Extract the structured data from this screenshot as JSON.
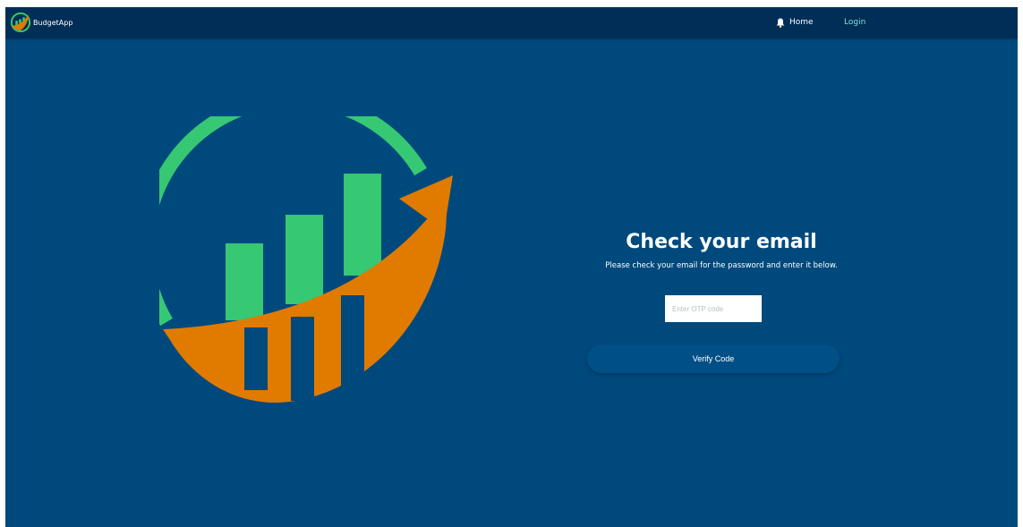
{
  "colors": {
    "page_background": "#00497d",
    "navbar_background": "#002e56",
    "login_link": "#7fe3d9",
    "logo_green": "#36c872",
    "logo_orange": "#e07b00",
    "button_background": "#004f86"
  },
  "navbar": {
    "brand_name": "BudgetApp",
    "brand_icon": "chart-growth-icon",
    "home_icon": "bell-icon",
    "home_label": "Home",
    "login_label": "Login"
  },
  "hero": {
    "logo_icon": "growth-chart-logo-icon"
  },
  "verify": {
    "title": "Check your email",
    "subtitle": "Please check your email for the password and enter it below.",
    "otp_placeholder": "Enter OTP code",
    "otp_value": "",
    "button_label": "Verify Code"
  }
}
